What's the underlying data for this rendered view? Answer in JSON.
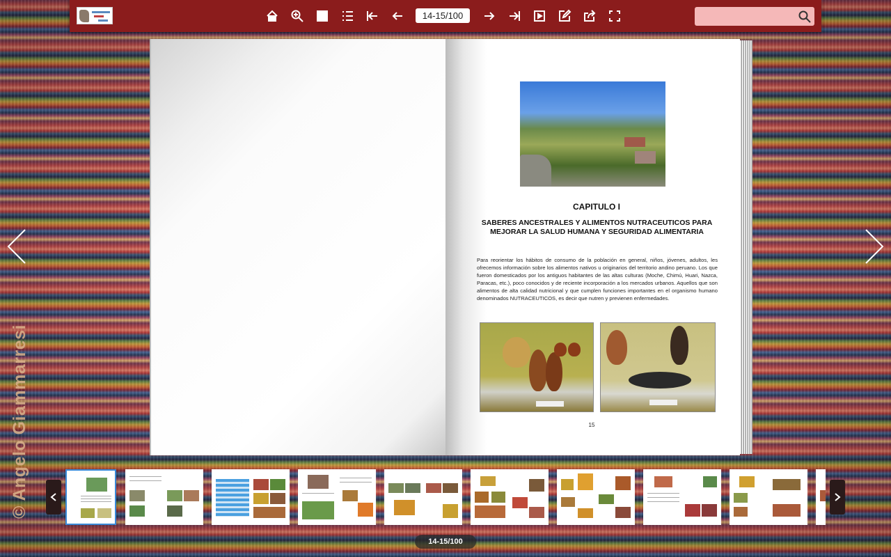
{
  "toolbar": {
    "page_indicator": "14-15/100",
    "search_placeholder": "",
    "buttons": [
      "home-icon",
      "zoom-in-icon",
      "thumbnails-icon",
      "table-of-contents-icon",
      "first-page-icon",
      "previous-page-icon",
      "next-page-icon",
      "last-page-icon",
      "autoplay-icon",
      "notes-icon",
      "share-icon",
      "fullscreen-icon"
    ]
  },
  "watermark": "© Angelo Giammarresi",
  "page15": {
    "chapter_title": "CAPITULO I",
    "subtitle": "SABERES ANCESTRALES Y ALIMENTOS NUTRACEUTICOS PARA MEJORAR LA SALUD HUMANA Y SEGURIDAD ALIMENTARIA",
    "body": "Para reorientar los hábitos de consumo de la población en general, niños, jóvenes, adultos, les ofrecemos información sobre los alimentos nativos u originarios del territorio andino peruano. Los que fueron domesticados por los antiguos habitantes de las altas culturas (Moche, Chimú, Huari, Nazca, Paracas, etc.), poco conocidos y de reciente incorporación a los mercados urbanos. Aquellos que son alimentos de alta calidad nutricional y que cumplen funciones importantes en el organismo humano denominados NUTRACEUTICOS, es decir que nutren y previenen enfermedades.",
    "page_number": "15"
  },
  "thumbnails": {
    "active_index": 0,
    "count": 10
  },
  "page_label": "14-15/100",
  "colors": {
    "toolbar": "#8b1c1c",
    "search_bg": "#f5b8b8",
    "active_thumb_border": "#3a8ad8"
  }
}
